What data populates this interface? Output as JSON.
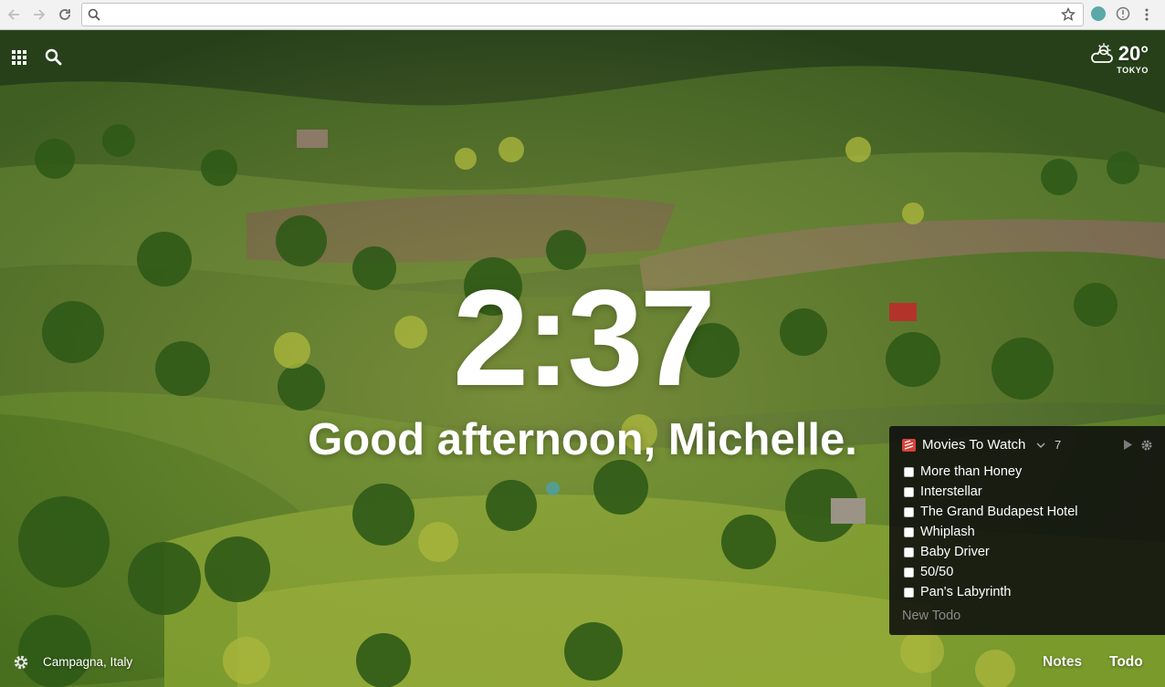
{
  "browser": {
    "address_value": "",
    "icons": [
      "back-icon",
      "forward-icon",
      "reload-icon",
      "search-icon",
      "bookmark-star-icon",
      "extension-icon",
      "info-icon",
      "menu-icon"
    ]
  },
  "top": {
    "apps_icon": "grid-icon",
    "search_icon": "search-icon",
    "weather": {
      "icon": "partly-cloudy-icon",
      "temperature": "20°",
      "city": "TOKYO"
    }
  },
  "center": {
    "time": "2:37",
    "greeting": "Good afternoon, Michelle."
  },
  "todo": {
    "list_title": "Movies To Watch",
    "count": "7",
    "items": [
      {
        "label": "More than Honey",
        "done": false
      },
      {
        "label": "Interstellar",
        "done": false
      },
      {
        "label": "The Grand Budapest Hotel",
        "done": false
      },
      {
        "label": "Whiplash",
        "done": false
      },
      {
        "label": "Baby Driver",
        "done": false
      },
      {
        "label": "50/50",
        "done": false
      },
      {
        "label": "Pan's Labyrinth",
        "done": false
      }
    ],
    "new_placeholder": "New Todo"
  },
  "bottom": {
    "location": "Campagna, Italy",
    "notes_label": "Notes",
    "todo_label": "Todo"
  },
  "colors": {
    "accent_teal": "#5aa8a8",
    "panel_bg": "#0e0e0e",
    "list_icon_red": "#d6423a"
  }
}
